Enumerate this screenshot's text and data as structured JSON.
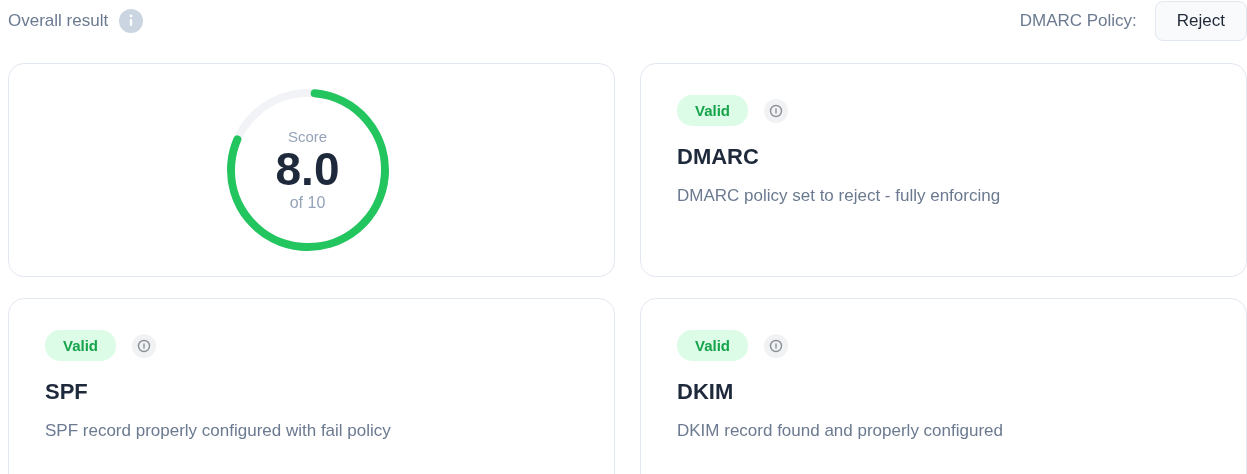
{
  "header": {
    "title": "Overall result",
    "policy_label": "DMARC Policy:",
    "policy_value": "Reject"
  },
  "score": {
    "label": "Score",
    "value": "8.0",
    "suffix": "of 10",
    "level": 0.8
  },
  "checks": [
    {
      "name": "DMARC",
      "badge": "Valid",
      "kind": "valid",
      "description": "DMARC policy set to reject - fully enforcing"
    },
    {
      "name": "SPF",
      "badge": "Valid",
      "kind": "valid",
      "description": "SPF record properly configured with fail policy"
    },
    {
      "name": "DKIM",
      "badge": "Valid",
      "kind": "valid",
      "description": "DKIM record found and properly configured"
    }
  ]
}
